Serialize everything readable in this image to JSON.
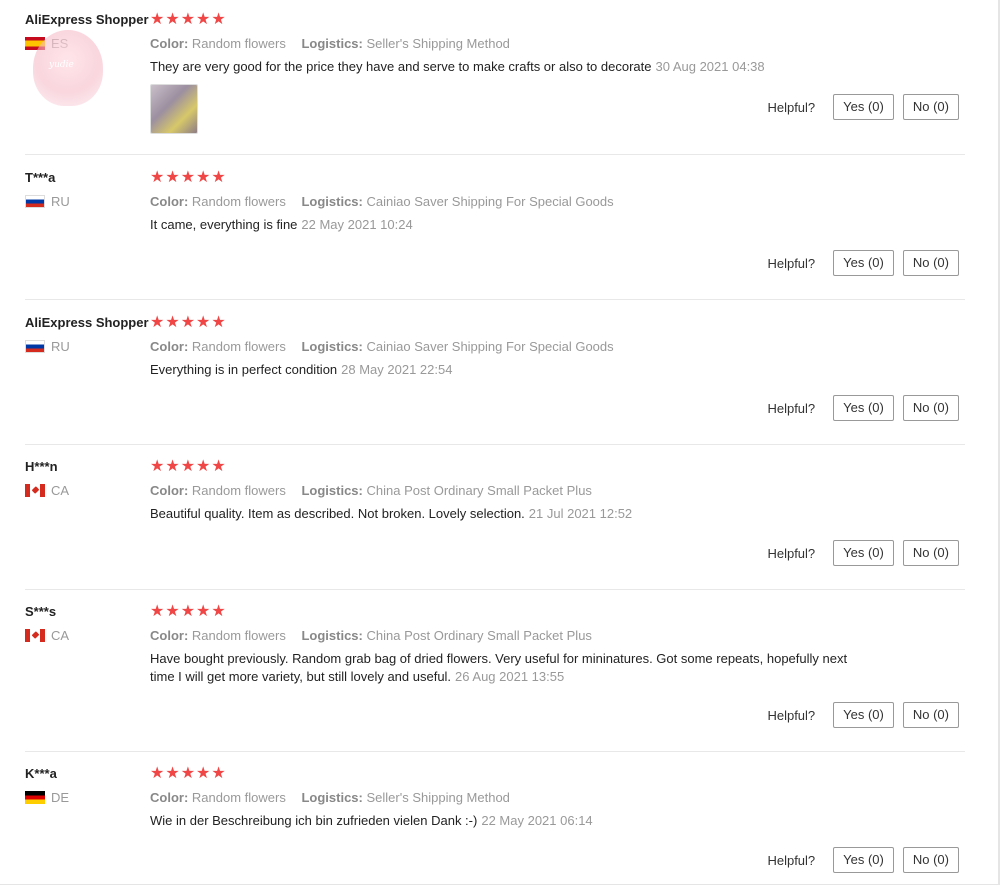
{
  "ui": {
    "helpful_label": "Helpful?",
    "yes_label": "Yes (0)",
    "no_label": "No (0)",
    "color_key": "Color:",
    "logistics_key": "Logistics:",
    "star_color": "#f04646"
  },
  "watermark": {
    "text": "yudie"
  },
  "reviews": [
    {
      "user": "AliExpress Shopper",
      "country": "ES",
      "rating": 5,
      "stars": "★★★★★",
      "color": "Random flowers",
      "logistics": "Seller's Shipping Method",
      "text": "They are very good for the price they have and serve to make crafts or also to decorate",
      "date": "30 Aug 2021 04:38",
      "has_photo": true
    },
    {
      "user": "T***a",
      "country": "RU",
      "rating": 5,
      "stars": "★★★★★",
      "color": "Random flowers",
      "logistics": "Cainiao Saver Shipping For Special Goods",
      "text": "It came, everything is fine",
      "date": "22 May 2021 10:24"
    },
    {
      "user": "AliExpress Shopper",
      "country": "RU",
      "rating": 5,
      "stars": "★★★★★",
      "color": "Random flowers",
      "logistics": "Cainiao Saver Shipping For Special Goods",
      "text": "Everything is in perfect condition",
      "date": "28 May 2021 22:54"
    },
    {
      "user": "H***n",
      "country": "CA",
      "rating": 5,
      "stars": "★★★★★",
      "color": "Random flowers",
      "logistics": "China Post Ordinary Small Packet Plus",
      "text": "Beautiful quality. Item as described. Not broken. Lovely selection.",
      "date": "21 Jul 2021 12:52"
    },
    {
      "user": "S***s",
      "country": "CA",
      "rating": 5,
      "stars": "★★★★★",
      "color": "Random flowers",
      "logistics": "China Post Ordinary Small Packet Plus",
      "text": "Have bought previously. Random grab bag of dried flowers. Very useful for mininatures. Got some repeats, hopefully next time I will get more variety, but still lovely and useful.",
      "date": "26 Aug 2021 13:55"
    },
    {
      "user": "K***a",
      "country": "DE",
      "rating": 5,
      "stars": "★★★★★",
      "color": "Random flowers",
      "logistics": "Seller's Shipping Method",
      "text": "Wie in der Beschreibung ich bin zufrieden vielen Dank :-)",
      "date": "22 May 2021 06:14"
    }
  ]
}
